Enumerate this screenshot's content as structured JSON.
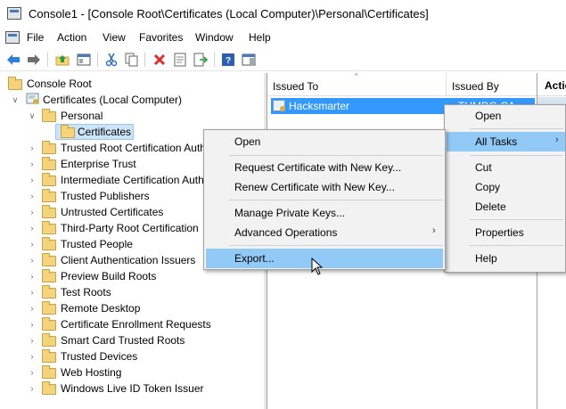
{
  "window": {
    "title": "Console1 - [Console Root\\Certificates (Local Computer)\\Personal\\Certificates]"
  },
  "menubar": {
    "items": [
      "File",
      "Action",
      "View",
      "Favorites",
      "Window",
      "Help"
    ]
  },
  "toolbar": {
    "icons": [
      "back-arrow-icon",
      "forward-arrow-icon",
      "up-folder-icon",
      "show-hide-tree-icon",
      "cut-icon",
      "copy-icon",
      "delete-icon",
      "properties-icon",
      "export-list-icon",
      "help-icon",
      "action-pane-icon"
    ]
  },
  "tree": {
    "root": "Console Root",
    "store": "Certificates (Local Computer)",
    "personal": "Personal",
    "certificates": "Certificates",
    "folders": [
      "Trusted Root Certification Auth",
      "Enterprise Trust",
      "Intermediate Certification Auth",
      "Trusted Publishers",
      "Untrusted Certificates",
      "Third-Party Root Certification",
      "Trusted People",
      "Client Authentication Issuers",
      "Preview Build Roots",
      "Test Roots",
      "Remote Desktop",
      "Certificate Enrollment Requests",
      "Smart Card Trusted Roots",
      "Trusted Devices",
      "Web Hosting",
      "Windows Live ID Token Issuer"
    ]
  },
  "list": {
    "columns": [
      "Issued To",
      "Issued By"
    ],
    "rows": [
      {
        "issued_to": "Hacksmarter",
        "issued_by": "THMDC-CA"
      }
    ]
  },
  "actions": {
    "header": "Actio"
  },
  "context_menu_main": {
    "items": [
      "Open",
      "Request Certificate with New Key...",
      "Renew Certificate with New Key...",
      "Manage Private Keys...",
      "Advanced Operations",
      "Export..."
    ],
    "highlighted": "Export..."
  },
  "context_menu_right": {
    "items": [
      "Open",
      "All Tasks",
      "Cut",
      "Copy",
      "Delete",
      "Properties",
      "Help"
    ],
    "highlighted": "All Tasks"
  },
  "colors": {
    "selection": "#3399ff",
    "menu_highlight": "#91c9f7",
    "folder": "#f5d37a"
  }
}
